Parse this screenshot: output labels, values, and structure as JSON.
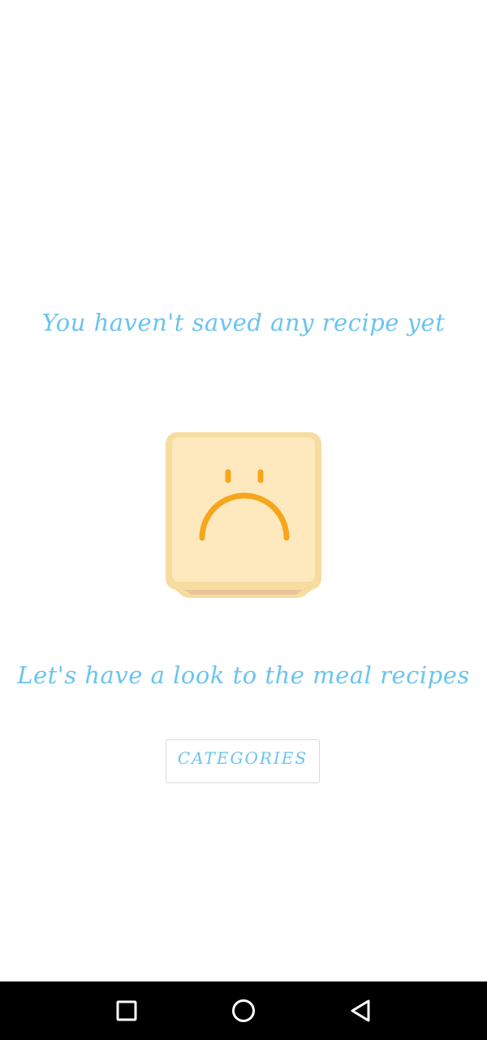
{
  "theme": {
    "accent": "#6ac4ef",
    "illustration_face": "#fde9bd",
    "illustration_border": "#f7dca0",
    "illustration_frown": "#f5a61d",
    "illustration_base": "#eac39a"
  },
  "empty_state": {
    "title": "You haven't saved any recipe yet",
    "illustration_icon": "sad-face-box-icon",
    "message": "Let's have a look to the meal recipes",
    "button_label": "CATEGORIES"
  },
  "system_nav": {
    "recents_icon": "square-icon",
    "home_icon": "circle-icon",
    "back_icon": "triangle-back-icon"
  }
}
